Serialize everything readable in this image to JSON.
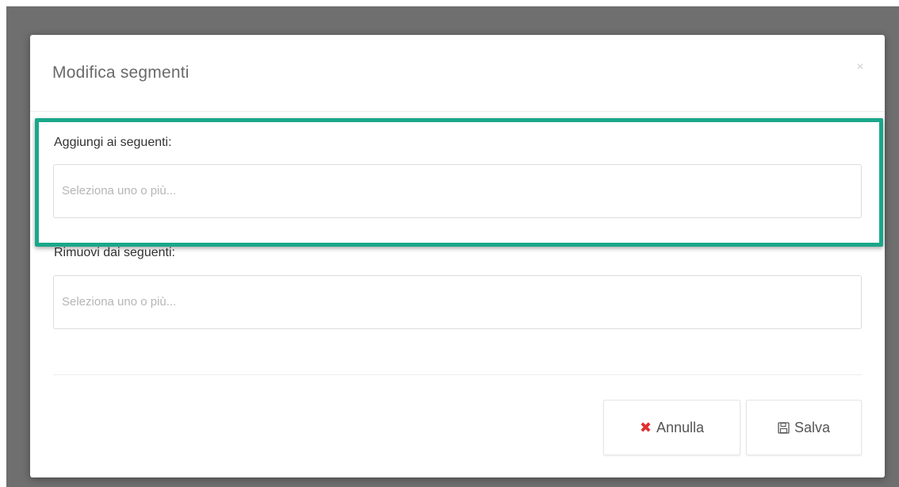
{
  "dialog": {
    "title": "Modifica segmenti",
    "close_symbol": "×"
  },
  "add_field": {
    "label": "Aggiungi ai seguenti:",
    "placeholder": "Seleziona uno o più..."
  },
  "remove_field": {
    "label": "Rimuovi dai seguenti:",
    "placeholder": "Seleziona uno o più..."
  },
  "buttons": {
    "cancel_label": "Annulla",
    "cancel_icon": "x-icon",
    "save_label": "Salva",
    "save_icon": "floppy-disk-icon"
  },
  "colors": {
    "highlight": "#1aa78a",
    "cancel_icon": "#e03030"
  }
}
